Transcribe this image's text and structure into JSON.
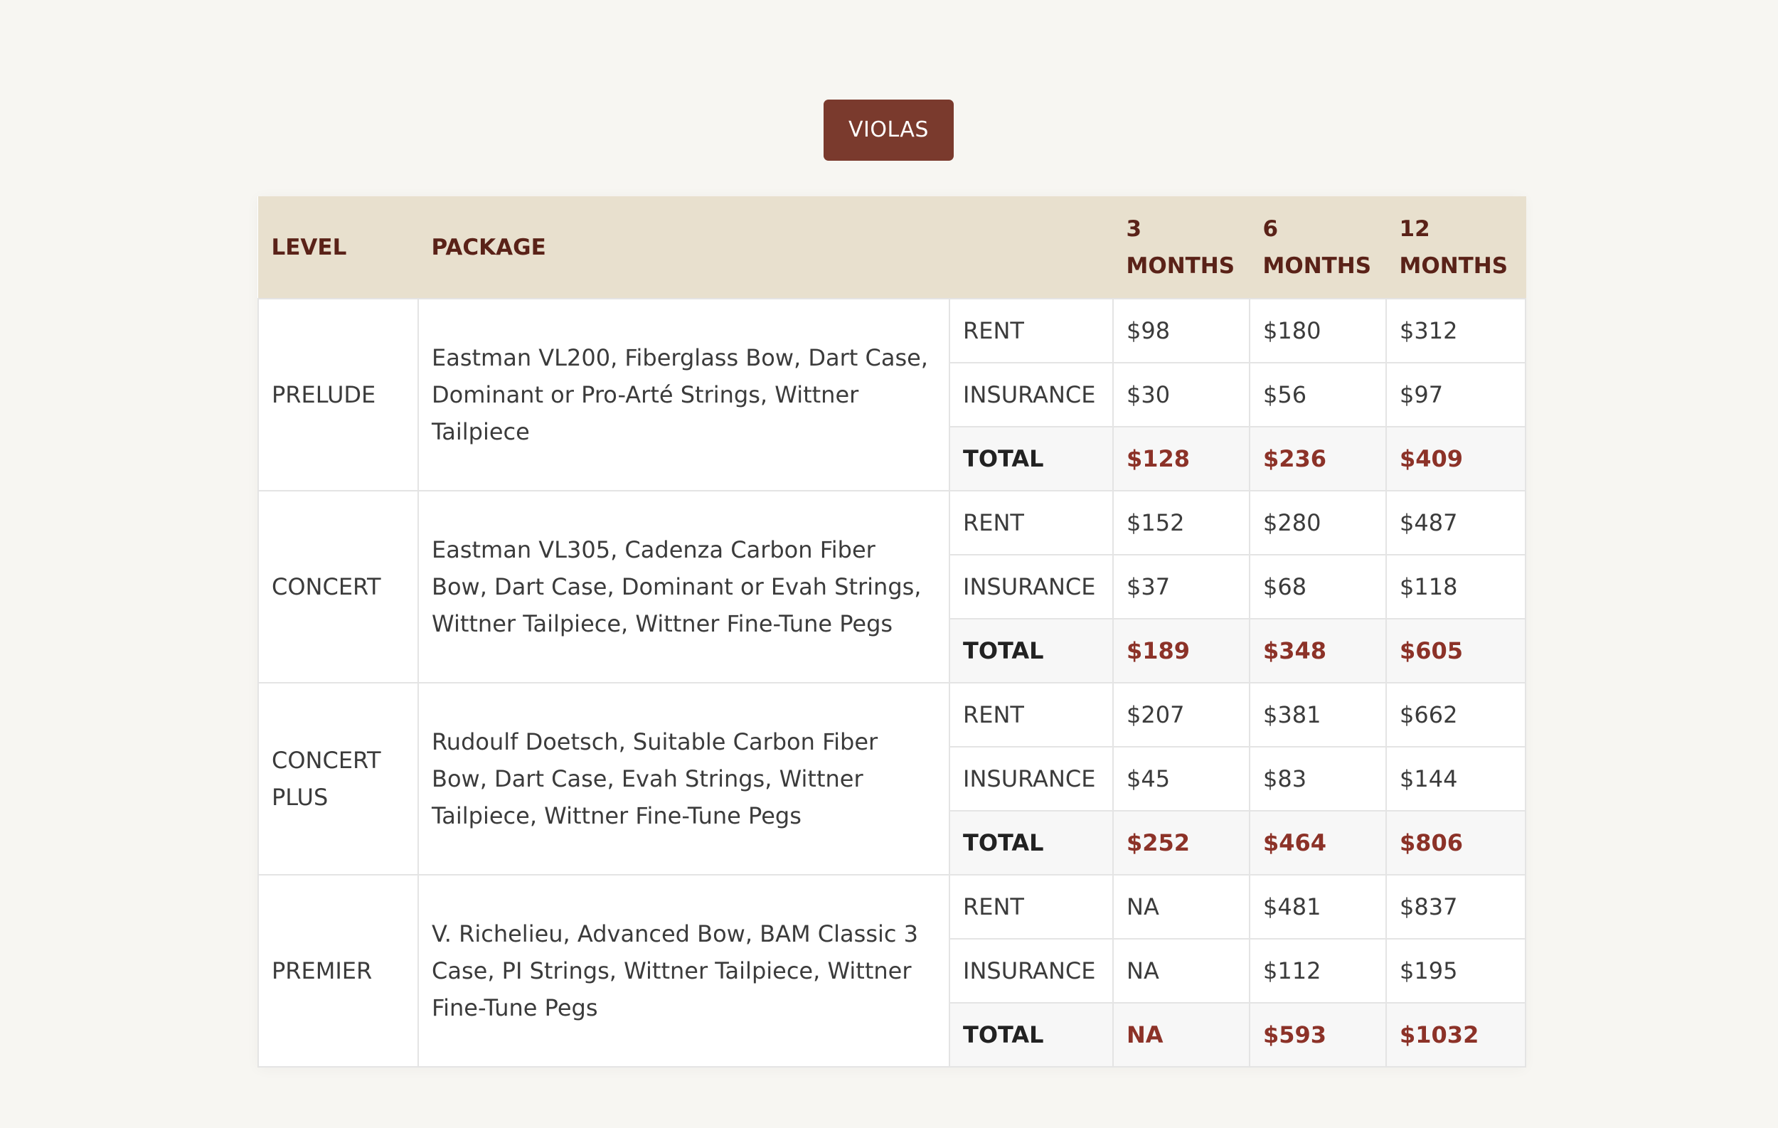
{
  "tab": {
    "label": "VIOLAS"
  },
  "table": {
    "headers": {
      "level": "LEVEL",
      "package": "PACKAGE",
      "type": "",
      "m3_num": "3",
      "m3_unit": "MONTHS",
      "m6_num": "6",
      "m6_unit": "MONTHS",
      "m12_num": "12",
      "m12_unit": "MONTHS"
    },
    "groups": [
      {
        "level": "PRELUDE",
        "package": "Eastman VL200, Fiberglass Bow, Dart Case, Dominant or Pro-Arté Strings, Wittner Tailpiece",
        "rows": [
          {
            "type": "RENT",
            "m3": "$98",
            "m6": "$180",
            "m12": "$312"
          },
          {
            "type": "INSURANCE",
            "m3": "$30",
            "m6": "$56",
            "m12": "$97"
          },
          {
            "type": "TOTAL",
            "m3": "$128",
            "m6": "$236",
            "m12": "$409"
          }
        ]
      },
      {
        "level": "CONCERT",
        "package": "Eastman VL305, Cadenza Carbon Fiber Bow, Dart Case, Dominant or Evah Strings, Wittner Tailpiece, Wittner Fine-Tune Pegs",
        "rows": [
          {
            "type": "RENT",
            "m3": "$152",
            "m6": "$280",
            "m12": "$487"
          },
          {
            "type": "INSURANCE",
            "m3": "$37",
            "m6": "$68",
            "m12": "$118"
          },
          {
            "type": "TOTAL",
            "m3": "$189",
            "m6": "$348",
            "m12": "$605"
          }
        ]
      },
      {
        "level": "CONCERT PLUS",
        "package": "Rudoulf Doetsch, Suitable Carbon Fiber Bow, Dart Case, Evah Strings, Wittner Tailpiece, Wittner Fine-Tune Pegs",
        "rows": [
          {
            "type": "RENT",
            "m3": "$207",
            "m6": "$381",
            "m12": "$662"
          },
          {
            "type": "INSURANCE",
            "m3": "$45",
            "m6": "$83",
            "m12": "$144"
          },
          {
            "type": "TOTAL",
            "m3": "$252",
            "m6": "$464",
            "m12": "$806"
          }
        ]
      },
      {
        "level": "PREMIER",
        "package": "V. Richelieu, Advanced Bow, BAM Classic 3 Case, PI Strings, Wittner Tailpiece, Wittner Fine-Tune Pegs",
        "rows": [
          {
            "type": "RENT",
            "m3": "NA",
            "m6": "$481",
            "m12": "$837"
          },
          {
            "type": "INSURANCE",
            "m3": "NA",
            "m6": "$112",
            "m12": "$195"
          },
          {
            "type": "TOTAL",
            "m3": "NA",
            "m6": "$593",
            "m12": "$1032"
          }
        ]
      }
    ]
  }
}
